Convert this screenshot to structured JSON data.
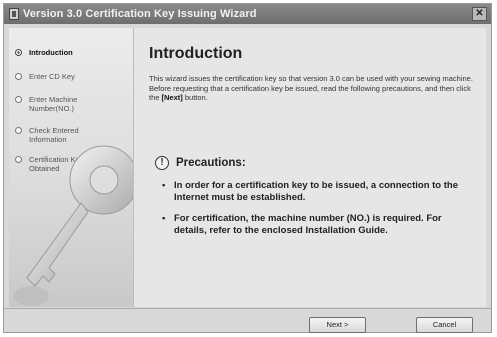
{
  "window": {
    "title": "Version 3.0 Certification Key Issuing Wizard",
    "close_glyph": "✕"
  },
  "sidebar": {
    "steps": [
      {
        "label": "Introduction",
        "active": true
      },
      {
        "label": "Enter CD Key",
        "active": false
      },
      {
        "label": "Enter Machine Number(NO.)",
        "active": false
      },
      {
        "label": "Check Entered Information",
        "active": false
      },
      {
        "label": "Certification Key Obtained",
        "active": false
      }
    ]
  },
  "main": {
    "heading": "Introduction",
    "intro_line1": "This wizard issues the certification key so that version 3.0 can be used with your sewing machine.",
    "intro_line2_before": "Before requesting that a certification key be issued, read the following precautions, and then click the ",
    "intro_line2_bold": "[Next]",
    "intro_line2_after": " button.",
    "precautions_icon": "!",
    "precautions_title": "Precautions:",
    "precautions": [
      "In order for a certification key to be issued, a connection to the Internet must be established.",
      "For certification, the machine number (NO.) is required. For details, refer to the enclosed Installation Guide."
    ]
  },
  "buttons": {
    "next": "Next >",
    "cancel": "Cancel"
  }
}
